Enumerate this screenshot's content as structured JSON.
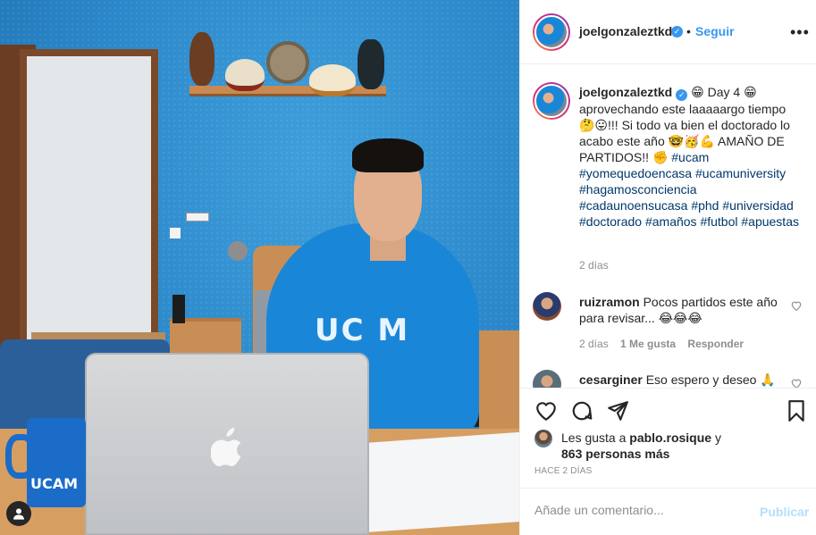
{
  "post": {
    "username": "joelgonzaleztkd",
    "verified_mark": "✓",
    "separator": "•",
    "follow_label": "Seguir",
    "more_label": "•••",
    "caption": {
      "username": "joelgonzaleztkd",
      "part1": " 😁 Day 4 😁 aprovechando este laaaaargo tiempo 🤔😛!!! Si todo va bien el doctorado lo acabo este año 🤓🥳💪 AMAÑO DE PARTIDOS!! ✊ ",
      "hashtags": [
        "#ucam",
        "#yomequedoencasa",
        "#ucamuniversity",
        "#hagamosconciencia",
        "#cadaunoensucasa",
        "#phd",
        "#universidad",
        "#doctorado",
        "#amaños",
        "#futbol",
        "#apuestas"
      ],
      "time": "2 días"
    },
    "comments": [
      {
        "username": "ruizramon",
        "text": "Pocos partidos este año para revisar... 😂😂😂",
        "time": "2 días",
        "likes": "1 Me gusta",
        "reply": "Responder"
      },
      {
        "username": "cesarginer",
        "text": "Eso espero y deseo 🙏",
        "time": "",
        "likes": "",
        "reply": ""
      }
    ],
    "likes": {
      "prefix": "Les gusta a ",
      "user": "pablo.rosique",
      "connector": " y ",
      "count": "863 personas más"
    },
    "date": "HACE 2 DÍAS",
    "comment_placeholder": "Añade un comentario...",
    "publish_label": "Publicar"
  },
  "photo": {
    "hood_text": "UC M",
    "mug_text": "UCAM",
    "apple_logo": ""
  },
  "icons": [
    "heart-icon",
    "comment-icon",
    "share-icon",
    "bookmark-icon",
    "user-tag-icon",
    "more-icon",
    "verified-icon"
  ],
  "colors": {
    "accent": "#3897f0",
    "hashtag": "#00376b",
    "muted": "#8e8e8e",
    "publish_disabled": "#b2dffc"
  }
}
